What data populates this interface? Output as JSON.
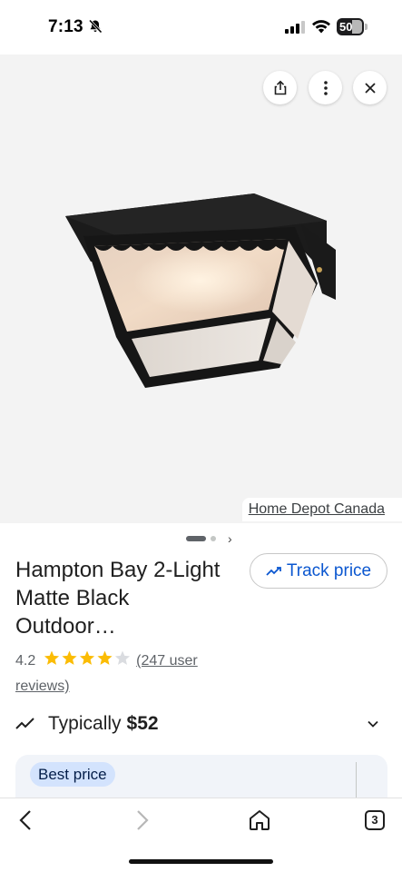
{
  "status_bar": {
    "time": "7:13",
    "battery": "50"
  },
  "image_viewer": {
    "source": "Home Depot Canada",
    "icons": {
      "share": "share-icon",
      "more": "more-vert-icon",
      "close": "close-icon"
    },
    "pager": {
      "next": "›"
    }
  },
  "product": {
    "title": "Hampton Bay 2-Light Matte Black Outdoor…",
    "track_price_label": "Track price",
    "rating": "4.2",
    "stars_filled": 4,
    "stars_total": 5,
    "reviews": "(247 user reviews)",
    "typical_label": "Typically",
    "typical_price": "$52"
  },
  "offers": {
    "best_price_label": "Best price"
  },
  "toolbar": {
    "tab_count": "3"
  },
  "colors": {
    "accent": "#0b57d0",
    "star": "#fbbc04",
    "pill_bg": "#d3e3fd"
  }
}
